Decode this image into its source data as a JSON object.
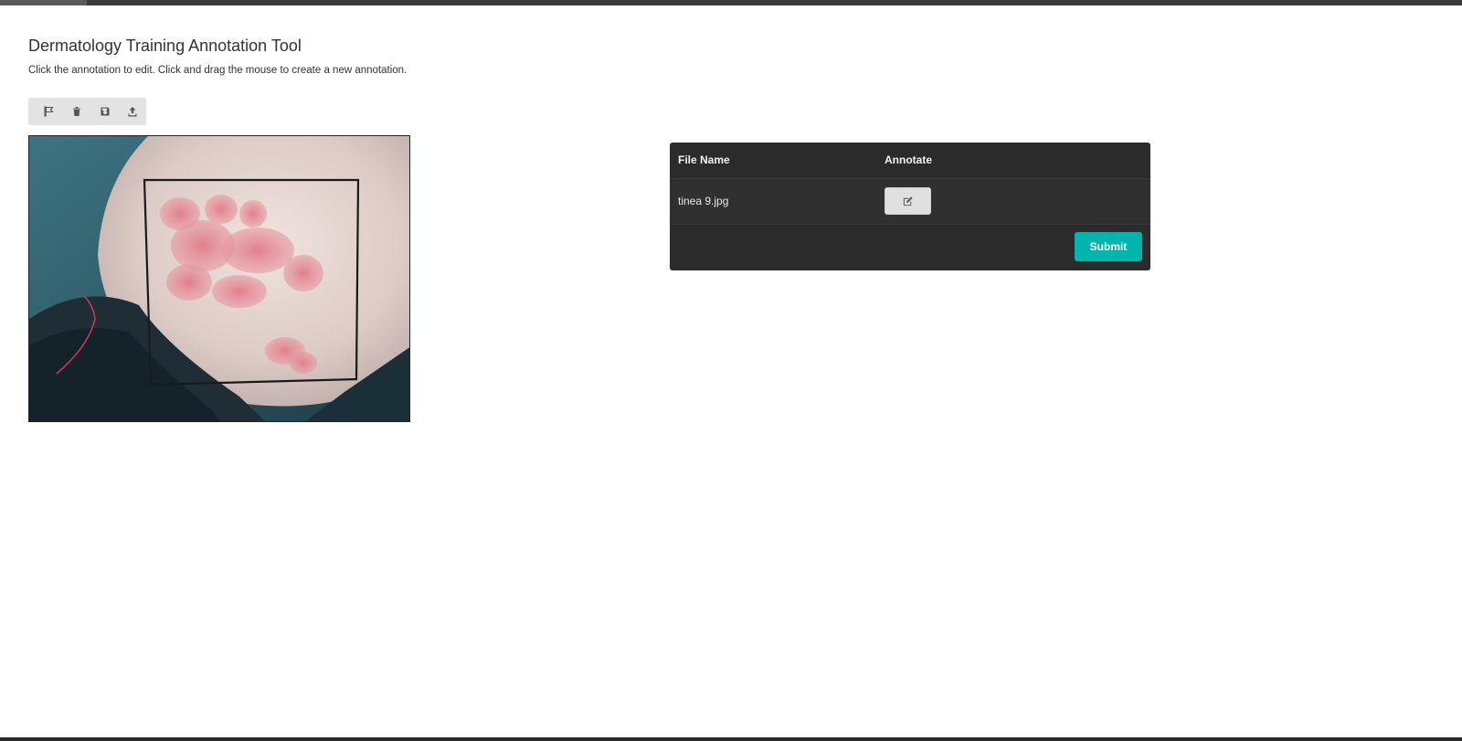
{
  "page": {
    "title": "Dermatology Training Annotation Tool",
    "subtitle": "Click the annotation to edit. Click and drag the mouse to create a new annotation."
  },
  "toolbar": {
    "tools": [
      {
        "icon": "flag-select-icon"
      },
      {
        "icon": "trash-icon"
      },
      {
        "icon": "save-icon"
      },
      {
        "icon": "upload-icon"
      }
    ]
  },
  "image": {
    "description_icon": "skin-lesion-photo"
  },
  "table": {
    "headers": {
      "file_name": "File Name",
      "annotate": "Annotate"
    },
    "rows": [
      {
        "file_name": "tinea 9.jpg",
        "annotate_icon": "edit-icon"
      }
    ],
    "submit_label": "Submit"
  },
  "colors": {
    "submit": "#00b5ad",
    "table_bg": "#2b2b2b"
  }
}
